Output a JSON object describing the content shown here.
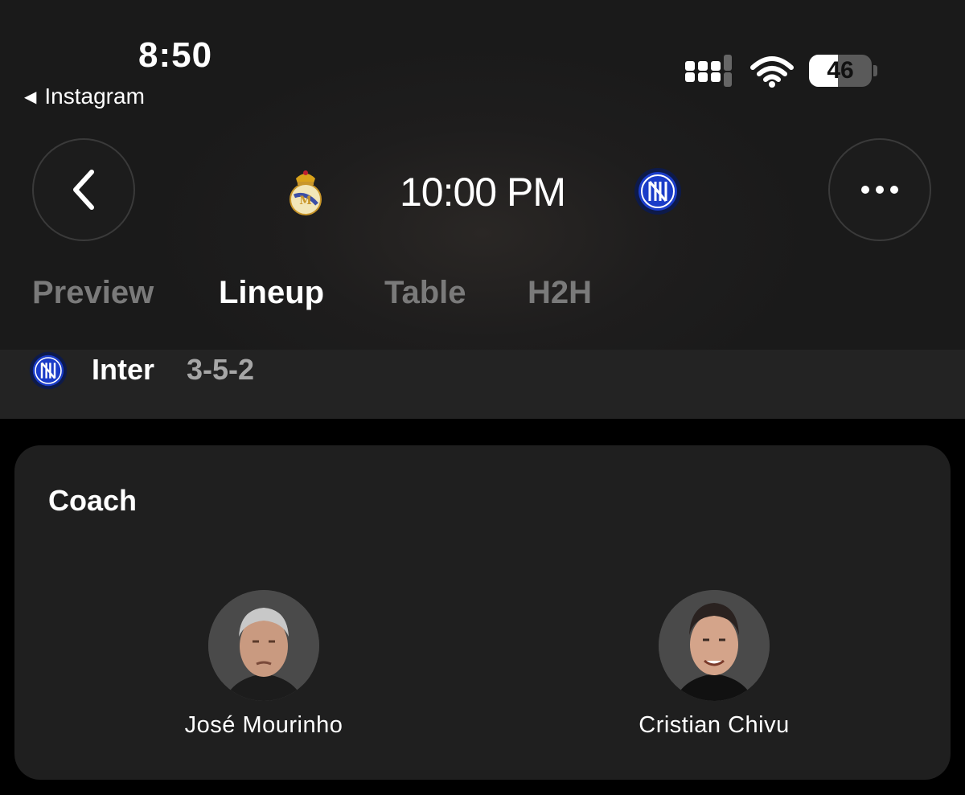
{
  "status_bar": {
    "time": "8:50",
    "back_app": "Instagram",
    "battery": "46",
    "battery_level": 0.46
  },
  "header": {
    "kickoff": "10:00 PM",
    "home_crest_icon": "real-madrid-crest-icon",
    "away_crest_icon": "inter-crest-icon"
  },
  "tabs": [
    {
      "label": "Preview",
      "active": false
    },
    {
      "label": "Lineup",
      "active": true
    },
    {
      "label": "Table",
      "active": false
    },
    {
      "label": "H2H",
      "active": false
    }
  ],
  "team": {
    "name": "Inter",
    "formation": "3-5-2"
  },
  "coach_card": {
    "title": "Coach",
    "coaches": [
      {
        "name": "José Mourinho"
      },
      {
        "name": "Cristian Chivu"
      }
    ]
  },
  "colors": {
    "background": "#000000",
    "header_bg": "#1a1a1a",
    "card_bg": "#1f1f1f",
    "inactive_tab": "#7a7a7a",
    "inter_blue": "#1a3cc8"
  }
}
